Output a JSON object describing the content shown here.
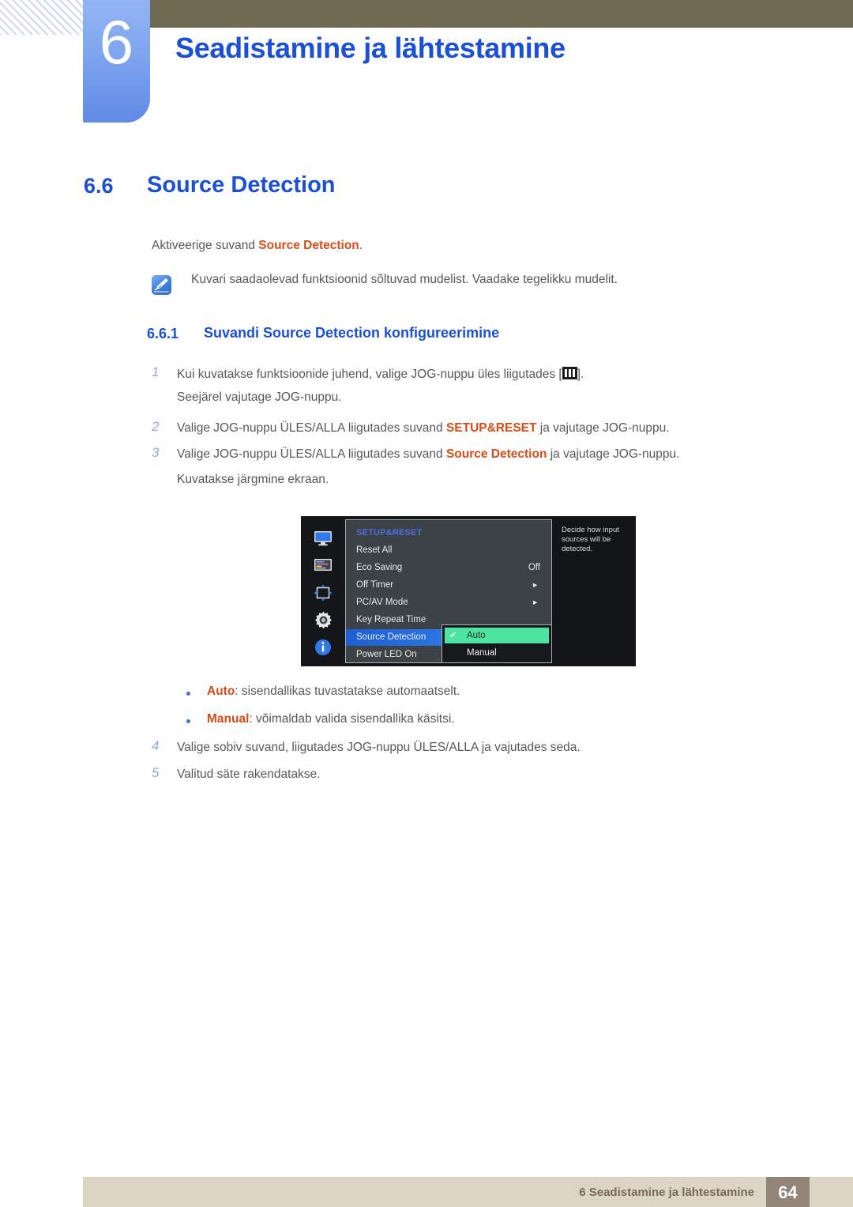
{
  "header": {
    "chapter_number": "6",
    "chapter_title": "Seadistamine ja lähtestamine",
    "stripes_icon": "diagonal-stripes-decoration"
  },
  "section": {
    "number": "6.6",
    "title": "Source Detection"
  },
  "intro": {
    "before": "Aktiveerige suvand ",
    "highlight": "Source Detection",
    "after": "."
  },
  "note": {
    "icon": "note-pencil-icon",
    "text": "Kuvari saadaolevad funktsioonid sõltuvad mudelist. Vaadake tegelikku mudelit."
  },
  "subsection": {
    "number": "6.6.1",
    "title": "Suvandi Source Detection konfigureerimine"
  },
  "steps": [
    {
      "number": "1",
      "line1_before": "Kui kuvatakse funktsioonide juhend, valige JOG-nuppu üles liigutades [",
      "line1_after": "].",
      "line2": "Seejärel vajutage JOG-nuppu.",
      "glyph": "menu-bars-icon"
    },
    {
      "number": "2",
      "before": "Valige JOG-nuppu ÜLES/ALLA liigutades suvand ",
      "highlight": "SETUP&RESET",
      "after": " ja vajutage JOG-nuppu."
    },
    {
      "number": "3",
      "before": "Valige JOG-nuppu ÜLES/ALLA liigutades suvand ",
      "highlight": "Source Detection",
      "after": " ja vajutage JOG-nuppu.",
      "line2": "Kuvatakse järgmine ekraan."
    },
    {
      "number": "4",
      "text": "Valige sobiv suvand, liigutades JOG-nuppu ÜLES/ALLA ja vajutades seda."
    },
    {
      "number": "5",
      "text": "Valitud säte rakendatakse."
    }
  ],
  "bullets": [
    {
      "term": "Auto",
      "desc": ": sisendallikas tuvastatakse automaatselt."
    },
    {
      "term": "Manual",
      "desc": ": võimaldab valida sisendallika käsitsi."
    }
  ],
  "osd": {
    "menu_title": "SETUP&RESET",
    "sidebar_icons": [
      "monitor-icon",
      "picture-settings-icon",
      "screen-adjust-icon",
      "gear-icon",
      "info-icon"
    ],
    "rows": [
      {
        "label": "Reset All",
        "value": "",
        "arrow": "",
        "selected": false
      },
      {
        "label": "Eco Saving",
        "value": "Off",
        "arrow": "",
        "selected": false
      },
      {
        "label": "Off Timer",
        "value": "",
        "arrow": "►",
        "selected": false
      },
      {
        "label": "PC/AV Mode",
        "value": "",
        "arrow": "►",
        "selected": false
      },
      {
        "label": "Key Repeat Time",
        "value": "",
        "arrow": "",
        "selected": false
      },
      {
        "label": "Source Detection",
        "value": "",
        "arrow": "",
        "selected": true
      },
      {
        "label": "Power LED On",
        "value": "",
        "arrow": "",
        "selected": false
      }
    ],
    "submenu": [
      {
        "label": "Auto",
        "checked": "✔",
        "highlighted": true
      },
      {
        "label": "Manual",
        "checked": "",
        "highlighted": false
      }
    ],
    "help_text": "Decide how input sources will be detected."
  },
  "footer": {
    "text": "6 Seadistamine ja lähtestamine",
    "page": "64"
  },
  "colors": {
    "brand_blue": "#1a4fd6",
    "highlight_red": "#d94b17",
    "header_olive": "#6e6b52",
    "footer_beige": "#dbd5c3",
    "footer_page_brown": "#938679",
    "osd_select_blue": "#2f7ae8",
    "osd_submenu_green": "#4ce4a0"
  }
}
